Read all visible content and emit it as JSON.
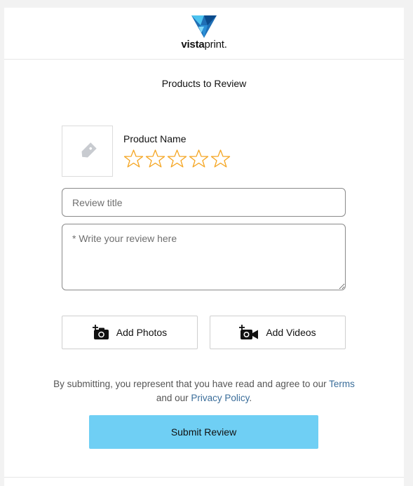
{
  "brand": {
    "name_bold": "vista",
    "name_regular": "print",
    "suffix": "."
  },
  "page": {
    "title": "Products to Review"
  },
  "product": {
    "name": "Product Name",
    "image_icon": "tag-icon",
    "rating": 0,
    "max_rating": 5,
    "star_color": "#f5a623"
  },
  "form": {
    "title_placeholder": "Review title",
    "body_placeholder": "* Write your review here"
  },
  "media": {
    "add_photos_label": "Add Photos",
    "add_photos_icon": "add-camera-icon",
    "add_videos_label": "Add Videos",
    "add_videos_icon": "add-video-camera-icon"
  },
  "disclaimer": {
    "text_before": "By submitting, you represent that you have read and agree to our ",
    "terms_label": "Terms",
    "text_middle": " and our ",
    "privacy_label": "Privacy Policy",
    "text_after": "."
  },
  "submit": {
    "label": "Submit Review",
    "color": "#6fcff4"
  }
}
